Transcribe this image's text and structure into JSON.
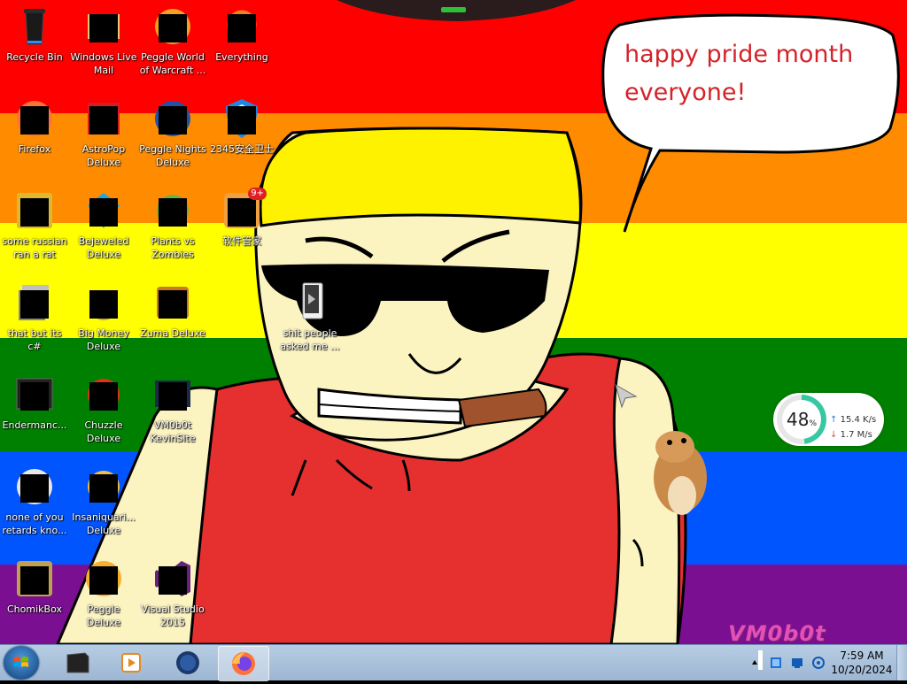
{
  "desktop": {
    "speech_bubble": {
      "line1": "happy pride month",
      "line2": "everyone!"
    },
    "watermark": "VM0b0t",
    "folder_icon": {
      "label_line1": "shit people",
      "label_line2": "asked me ..."
    },
    "icons": [
      {
        "id": "recycle-bin",
        "l1": "Recycle Bin",
        "l2": ""
      },
      {
        "id": "windows-live-mail",
        "l1": "Windows Live",
        "l2": "Mail"
      },
      {
        "id": "peggle-world-of-warcraft",
        "l1": "Peggle World",
        "l2": "of Warcraft ..."
      },
      {
        "id": "everything",
        "l1": "Everything",
        "l2": ""
      },
      {
        "id": "firefox",
        "l1": "Firefox",
        "l2": ""
      },
      {
        "id": "astropop-deluxe",
        "l1": "AstroPop",
        "l2": "Deluxe"
      },
      {
        "id": "peggle-nights-deluxe",
        "l1": "Peggle Nights",
        "l2": "Deluxe"
      },
      {
        "id": "2345-security",
        "l1": "2345安全卫士",
        "l2": ""
      },
      {
        "id": "some-russian-ran-a-rat",
        "l1": "some russian",
        "l2": "ran a rat"
      },
      {
        "id": "bejeweled-deluxe",
        "l1": "Bejeweled",
        "l2": "Deluxe"
      },
      {
        "id": "plants-vs-zombies",
        "l1": "Plants vs",
        "l2": "Zombies"
      },
      {
        "id": "software-manager",
        "l1": "软件管家",
        "l2": ""
      },
      {
        "id": "that-but-its-csharp",
        "l1": "that but its c#",
        "l2": ""
      },
      {
        "id": "big-money-deluxe",
        "l1": "Big Money",
        "l2": "Deluxe"
      },
      {
        "id": "zuma-deluxe",
        "l1": "Zuma Deluxe",
        "l2": ""
      },
      {
        "id": "endermanch",
        "l1": "Endermanc...",
        "l2": ""
      },
      {
        "id": "chuzzle-deluxe",
        "l1": "Chuzzle",
        "l2": "Deluxe"
      },
      {
        "id": "vm0b0t-kevinsite",
        "l1": "VM0b0t",
        "l2": "KevinSite"
      },
      {
        "id": "none-of-you-retards",
        "l1": "none of you",
        "l2": "retards kno..."
      },
      {
        "id": "insaniquarium-deluxe",
        "l1": "Insaniquari...",
        "l2": "Deluxe"
      },
      {
        "id": "chomikbox",
        "l1": "ChomikBox",
        "l2": ""
      },
      {
        "id": "peggle-deluxe",
        "l1": "Peggle Deluxe",
        "l2": ""
      },
      {
        "id": "visual-studio-2015",
        "l1": "Visual Studio",
        "l2": "2015"
      }
    ],
    "badge_count": "9+"
  },
  "network_widget": {
    "percent": "48",
    "percent_unit": "%",
    "upload": "15.4",
    "upload_unit": "K/s",
    "download": "1.7",
    "download_unit": "M/s",
    "percent_value": 48
  },
  "taskbar": {
    "clock_time": "7:59 AM",
    "clock_date": "10/20/2024",
    "pinned": [
      "terminal-icon",
      "media-player-icon",
      "network-globe-icon",
      "firefox-icon"
    ],
    "active_index": 3
  },
  "colors": {
    "stripe_red": "#ff0000",
    "stripe_orange": "#ff8c00",
    "stripe_yellow": "#ffff00",
    "stripe_green": "#008000",
    "stripe_blue": "#0055ff",
    "stripe_purple": "#7a0f91",
    "bubble_text": "#d3232a",
    "watermark": "#e64fb5"
  }
}
